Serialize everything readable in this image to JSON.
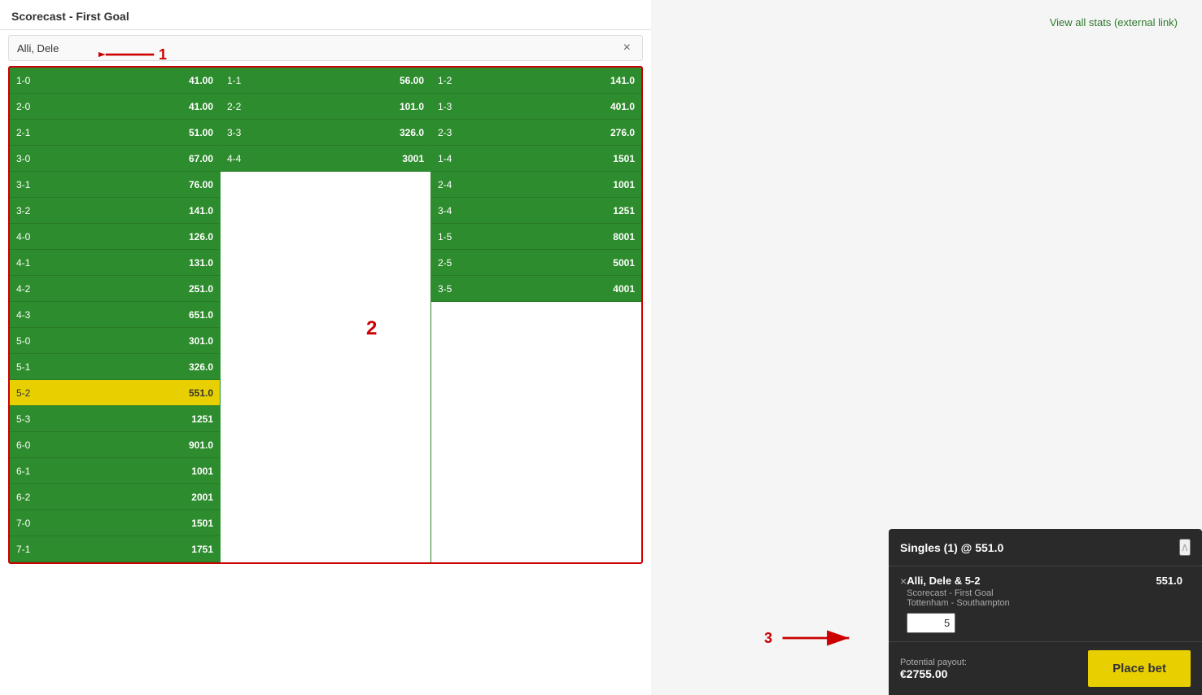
{
  "page": {
    "title": "Scorecast - First Goal",
    "viewAllStats": "View all stats (external link)",
    "playerName": "Alli, Dele",
    "closeButton": "×",
    "collapseButton": "∧",
    "annotation1": "1",
    "annotation2": "2",
    "annotation3": "3"
  },
  "grid": {
    "col1": [
      {
        "score": "1-0",
        "odds": "41.00"
      },
      {
        "score": "2-0",
        "odds": "41.00"
      },
      {
        "score": "2-1",
        "odds": "51.00"
      },
      {
        "score": "3-0",
        "odds": "67.00"
      },
      {
        "score": "3-1",
        "odds": "76.00"
      },
      {
        "score": "3-2",
        "odds": "141.0"
      },
      {
        "score": "4-0",
        "odds": "126.0"
      },
      {
        "score": "4-1",
        "odds": "131.0"
      },
      {
        "score": "4-2",
        "odds": "251.0"
      },
      {
        "score": "4-3",
        "odds": "651.0"
      },
      {
        "score": "5-0",
        "odds": "301.0"
      },
      {
        "score": "5-1",
        "odds": "326.0"
      },
      {
        "score": "5-2",
        "odds": "551.0",
        "selected": true
      },
      {
        "score": "5-3",
        "odds": "1251"
      },
      {
        "score": "6-0",
        "odds": "901.0"
      },
      {
        "score": "6-1",
        "odds": "1001"
      },
      {
        "score": "6-2",
        "odds": "2001"
      },
      {
        "score": "7-0",
        "odds": "1501"
      },
      {
        "score": "7-1",
        "odds": "1751"
      }
    ],
    "col2": [
      {
        "score": "1-1",
        "odds": "56.00"
      },
      {
        "score": "2-2",
        "odds": "101.0"
      },
      {
        "score": "3-3",
        "odds": "326.0"
      },
      {
        "score": "4-4",
        "odds": "3001"
      },
      {
        "score": "",
        "odds": ""
      },
      {
        "score": "",
        "odds": ""
      },
      {
        "score": "",
        "odds": ""
      },
      {
        "score": "",
        "odds": ""
      },
      {
        "score": "",
        "odds": ""
      },
      {
        "score": "",
        "odds": ""
      },
      {
        "score": "",
        "odds": ""
      },
      {
        "score": "",
        "odds": ""
      },
      {
        "score": "",
        "odds": ""
      },
      {
        "score": "",
        "odds": ""
      },
      {
        "score": "",
        "odds": ""
      },
      {
        "score": "",
        "odds": ""
      },
      {
        "score": "",
        "odds": ""
      },
      {
        "score": "",
        "odds": ""
      },
      {
        "score": "",
        "odds": ""
      }
    ],
    "col3": [
      {
        "score": "1-2",
        "odds": "141.0"
      },
      {
        "score": "1-3",
        "odds": "401.0"
      },
      {
        "score": "2-3",
        "odds": "276.0"
      },
      {
        "score": "1-4",
        "odds": "1501"
      },
      {
        "score": "2-4",
        "odds": "1001"
      },
      {
        "score": "3-4",
        "odds": "1251"
      },
      {
        "score": "1-5",
        "odds": "8001"
      },
      {
        "score": "2-5",
        "odds": "5001"
      },
      {
        "score": "3-5",
        "odds": "4001"
      },
      {
        "score": "",
        "odds": ""
      },
      {
        "score": "",
        "odds": ""
      },
      {
        "score": "",
        "odds": ""
      },
      {
        "score": "",
        "odds": ""
      },
      {
        "score": "",
        "odds": ""
      },
      {
        "score": "",
        "odds": ""
      },
      {
        "score": "",
        "odds": ""
      },
      {
        "score": "",
        "odds": ""
      },
      {
        "score": "",
        "odds": ""
      },
      {
        "score": "",
        "odds": ""
      }
    ]
  },
  "betSlip": {
    "title": "Singles (1) @ 551.0",
    "betName": "Alli, Dele & 5-2",
    "betMarket": "Scorecast - First Goal",
    "betMatch": "Tottenham - Southampton",
    "odds": "551.0",
    "stakeValue": "5",
    "potentialPayoutLabel": "Potential payout:",
    "potentialPayoutAmount": "€2755.00",
    "placeBetLabel": "Place bet"
  }
}
